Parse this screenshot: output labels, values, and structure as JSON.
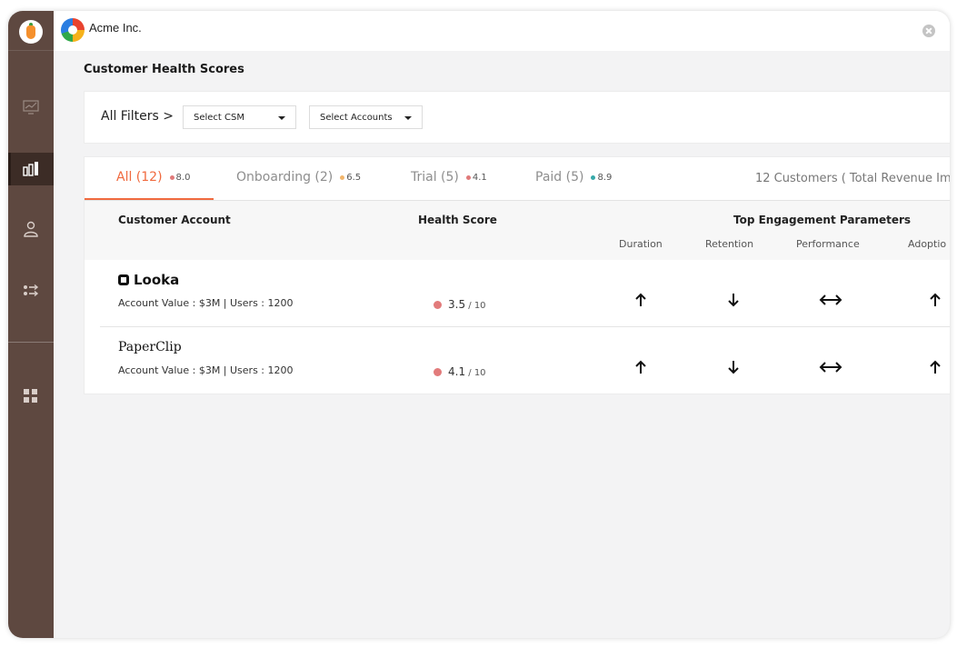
{
  "app": {
    "org_name": "Acme Inc."
  },
  "page_title": "Customer Health Scores",
  "filters": {
    "label": "All Filters >",
    "csm_dropdown": "Select CSM",
    "accounts_dropdown": "Select Accounts"
  },
  "tabs": [
    {
      "label": "All (12)",
      "score": "8.0",
      "dot_color": "#e07a7a",
      "active": true
    },
    {
      "label": "Onboarding (2)",
      "score": "6.5",
      "dot_color": "#f2b56b",
      "active": false
    },
    {
      "label": "Trial (5)",
      "score": "4.1",
      "dot_color": "#e07a7a",
      "active": false
    },
    {
      "label": "Paid (5)",
      "score": "8.9",
      "dot_color": "#37a9a9",
      "active": false
    }
  ],
  "summary": "12 Customers ( Total Revenue Imp",
  "table": {
    "col_account": "Customer Account",
    "col_health": "Health Score",
    "col_engagement": "Top Engagement Parameters",
    "sub_cols": [
      "Duration",
      "Retention",
      "Performance",
      "Adoptio"
    ],
    "rows": [
      {
        "name": "Looka",
        "meta": "Account Value : $3M |  Users : 1200",
        "score": "3.5",
        "score_out": " / 10",
        "trends": [
          "up",
          "down",
          "both",
          "up"
        ]
      },
      {
        "name": "PaperClip",
        "meta": "Account Value : $3M |  Users : 1200",
        "score": "4.1",
        "score_out": " / 10",
        "trends": [
          "up",
          "down",
          "both",
          "up"
        ]
      }
    ]
  },
  "colors": {
    "sidebar": "#5e4840",
    "sidebar_active": "#3c2c26",
    "accent": "#f06a3f",
    "health_dot": "#e27b7b"
  },
  "sidebar_icons": [
    "carrot-logo-icon",
    "monitor-chart-icon",
    "bar-chart-icon",
    "user-icon",
    "transfer-icon",
    "grid-icon"
  ]
}
